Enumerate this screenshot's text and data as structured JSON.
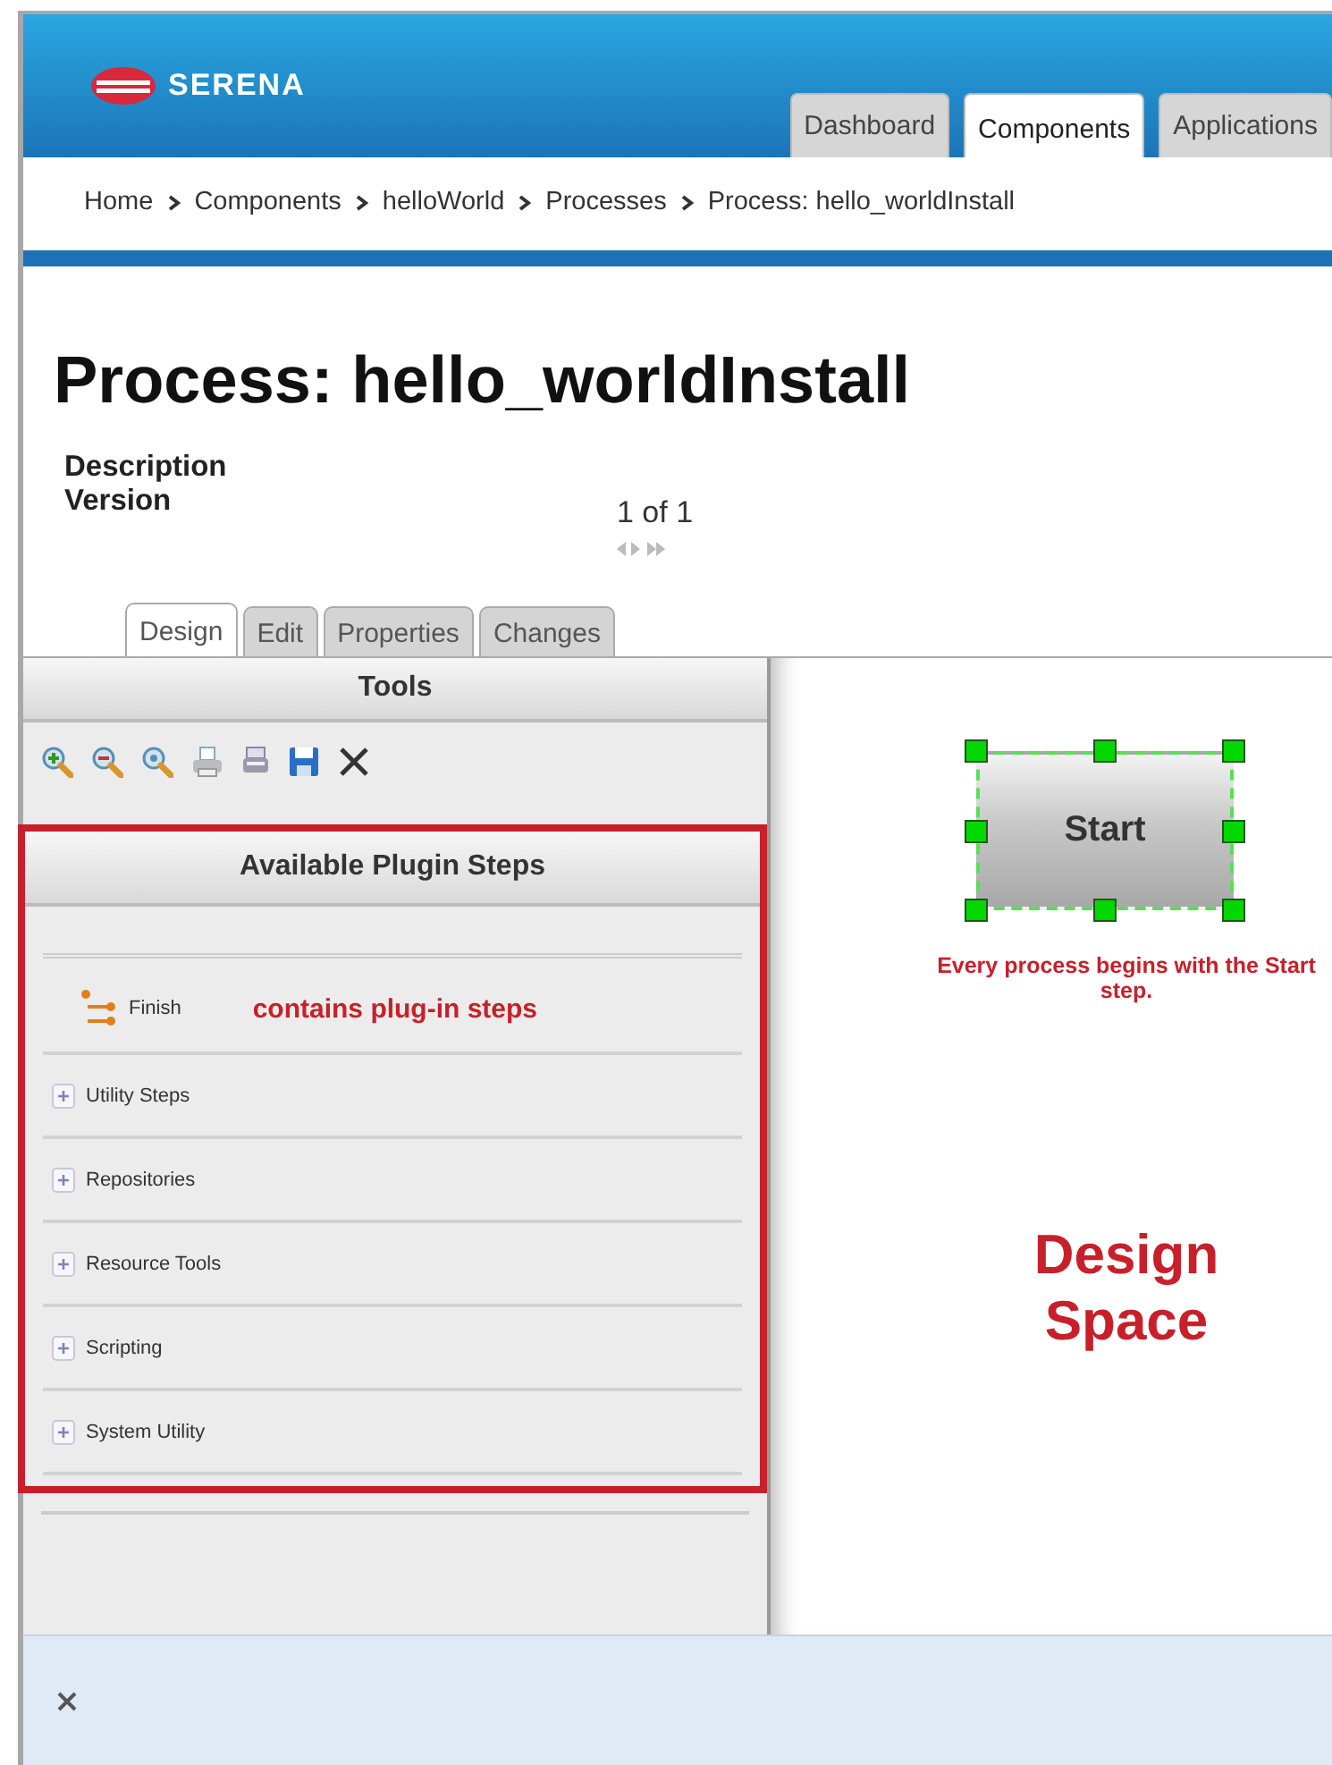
{
  "header": {
    "logo": "SERENA",
    "tabs": [
      {
        "label": "Dashboard",
        "selected": false
      },
      {
        "label": "Components",
        "selected": true
      },
      {
        "label": "Applications",
        "selected": false
      }
    ]
  },
  "breadcrumb": [
    "Home",
    "Components",
    "helloWorld",
    "Processes",
    "Process: hello_worldInstall"
  ],
  "page_title": "Process: hello_worldInstall",
  "fields": [
    {
      "label": "Description"
    },
    {
      "label": "Version",
      "value": "1 of 1"
    }
  ],
  "sub_tabs": [
    {
      "label": "Design",
      "selected": true
    },
    {
      "label": "Edit",
      "selected": false
    },
    {
      "label": "Properties",
      "selected": false
    },
    {
      "label": "Changes",
      "selected": false
    }
  ],
  "tools_panel": {
    "title": "Tools"
  },
  "plugin_steps": {
    "title": "Available Plugin Steps",
    "callout": "contains plug-in steps",
    "items": [
      {
        "label": "Finish",
        "kind": "step"
      },
      {
        "label": "Utility Steps",
        "kind": "group"
      },
      {
        "label": "Repositories",
        "kind": "group"
      },
      {
        "label": "Resource Tools",
        "kind": "group"
      },
      {
        "label": "Scripting",
        "kind": "group"
      },
      {
        "label": "System Utility",
        "kind": "group"
      }
    ]
  },
  "design_space": {
    "node": {
      "label": "Start",
      "selected": true
    },
    "note": "Every process begins with the Start step.",
    "label": "Design Space"
  }
}
